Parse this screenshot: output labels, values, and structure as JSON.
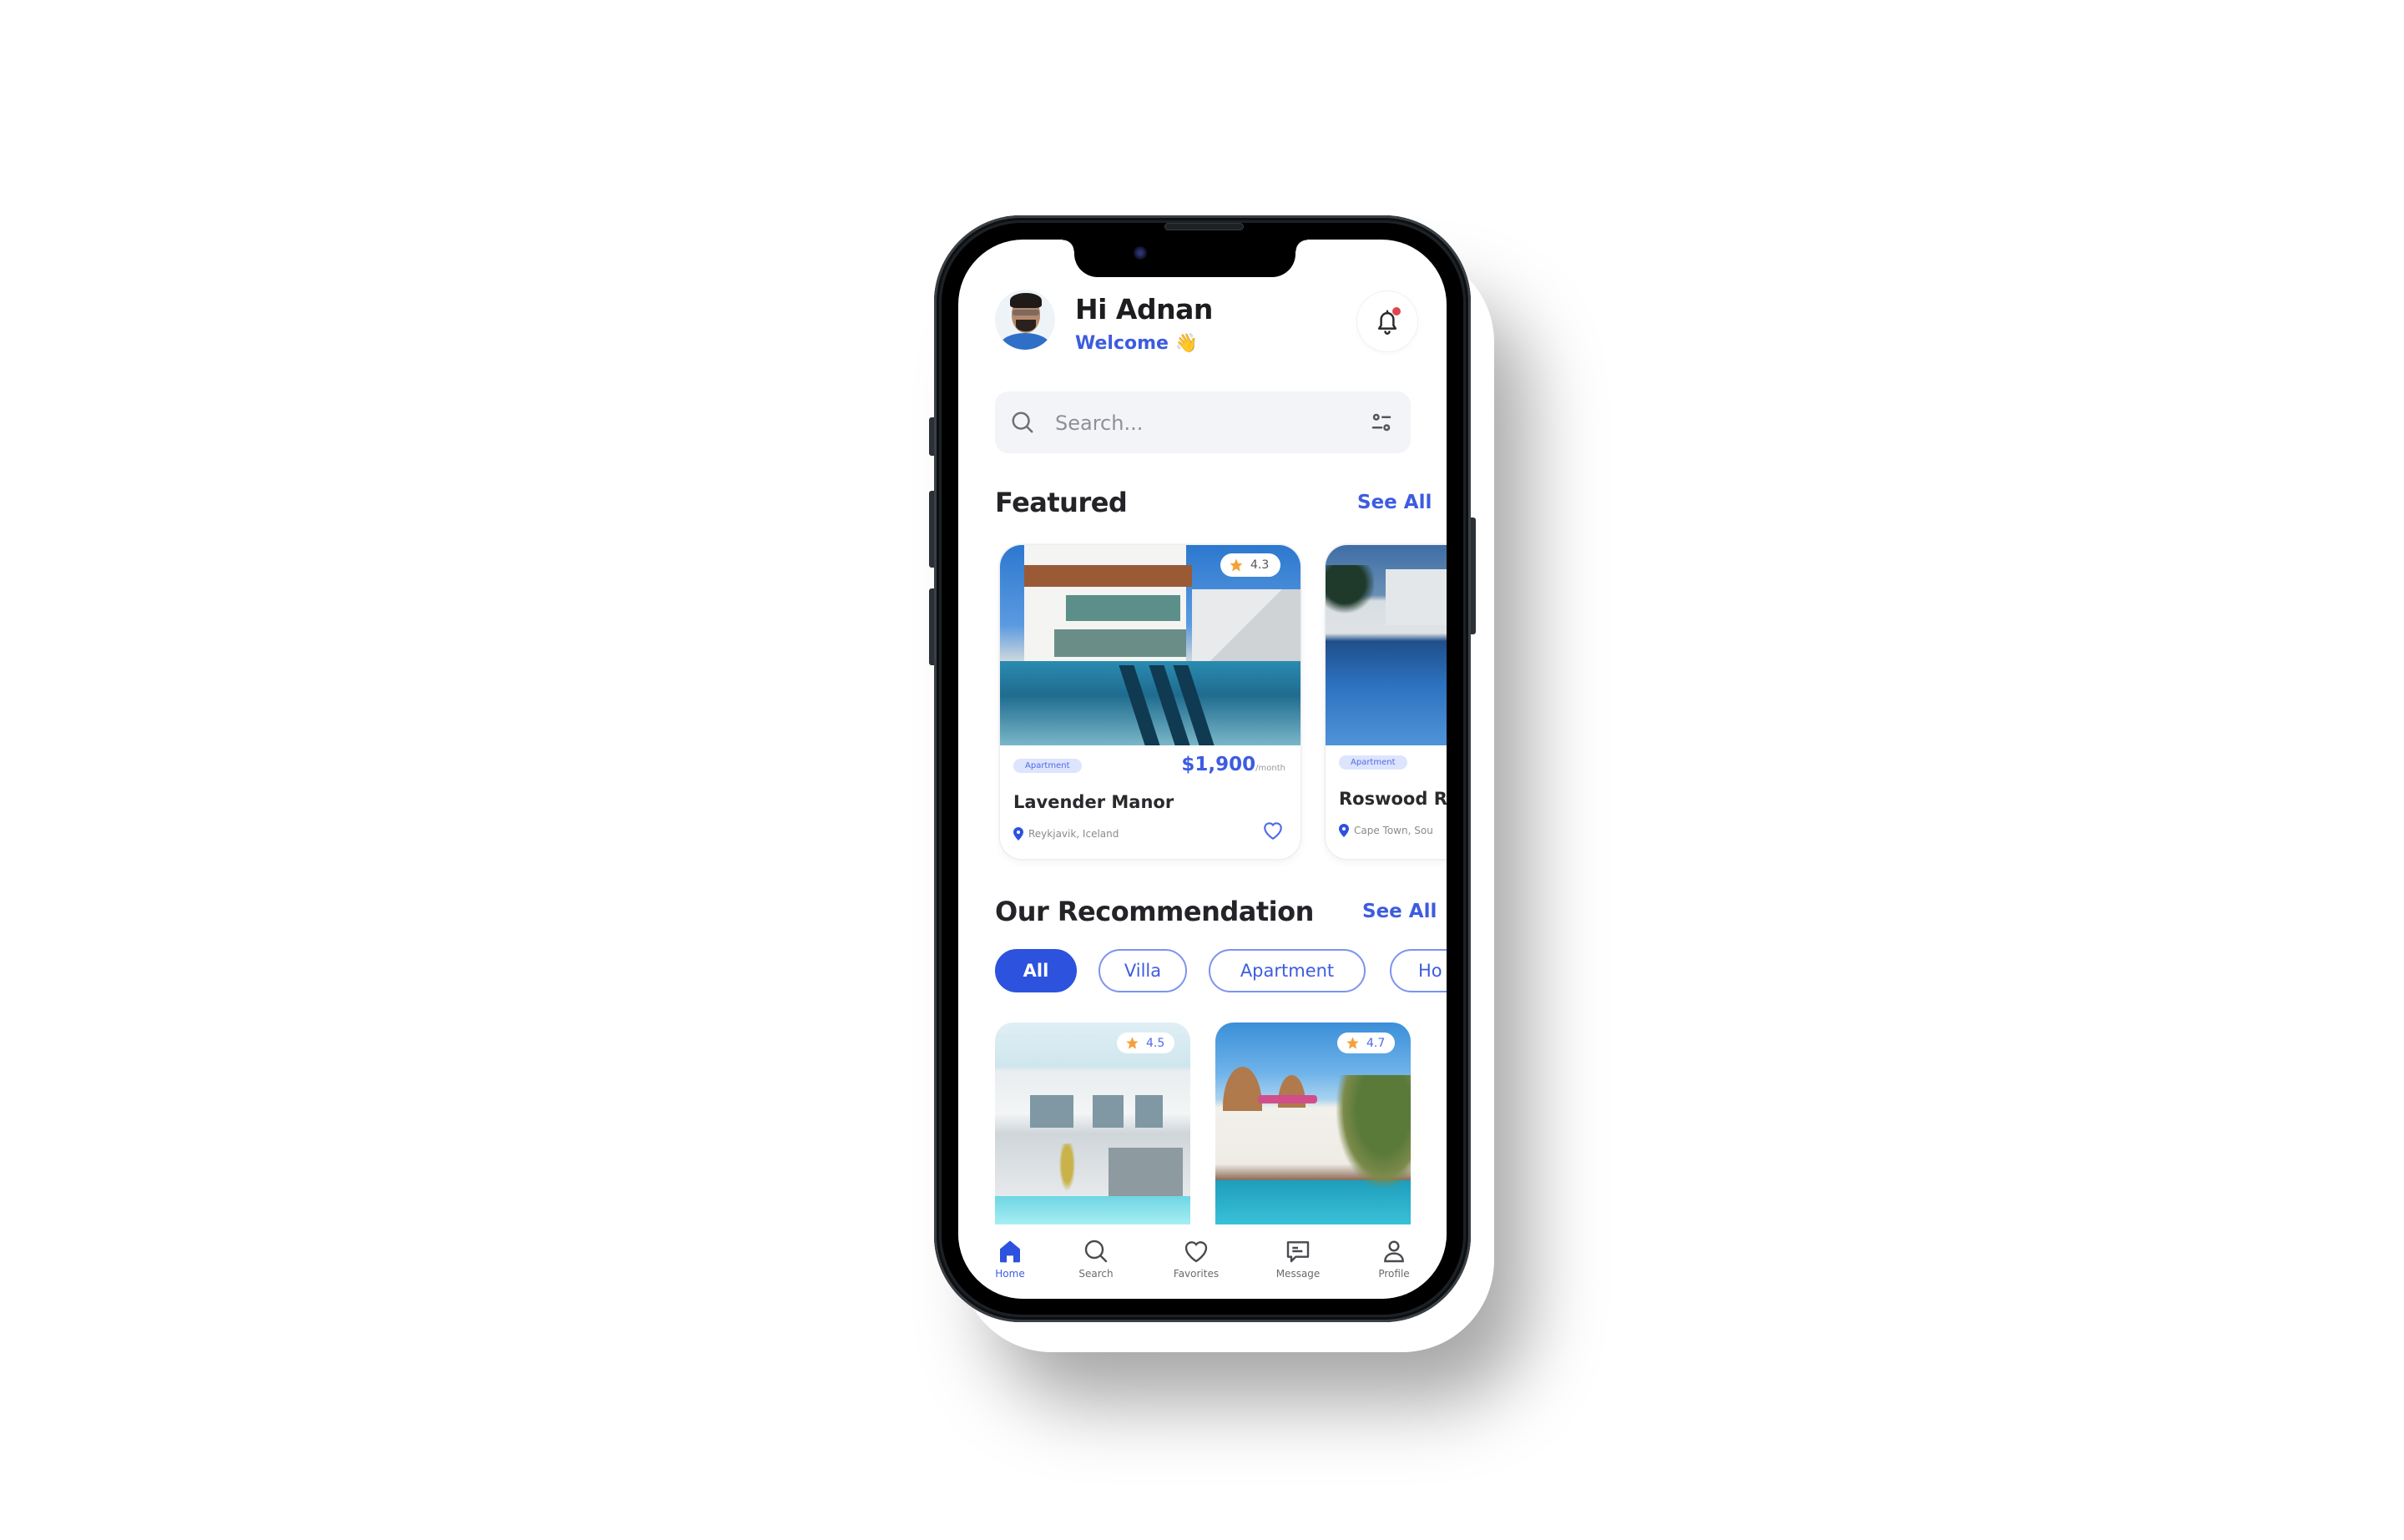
{
  "header": {
    "greeting": "Hi Adnan",
    "subtitle": "Welcome",
    "subtitle_emoji": "👋",
    "avatar_icon": "user-avatar",
    "notification_icon": "bell-icon",
    "has_unread_notification": true
  },
  "search": {
    "placeholder": "Search...",
    "value": "",
    "search_icon": "search-icon",
    "filter_icon": "filter-sliders-icon"
  },
  "featured": {
    "title": "Featured",
    "see_all": "See All",
    "cards": [
      {
        "rating": "4.3",
        "type": "Apartment",
        "price": "$1,900",
        "price_period": "/month",
        "name": "Lavender Manor",
        "location": "Reykjavik, Iceland",
        "favorite_icon": "heart-icon"
      },
      {
        "type": "Apartment",
        "name": "Roswood Re",
        "location": "Cape Town, Sou"
      }
    ]
  },
  "recommendation": {
    "title": "Our Recommendation",
    "see_all": "See All",
    "filters": [
      {
        "label": "All",
        "active": true
      },
      {
        "label": "Villa",
        "active": false
      },
      {
        "label": "Apartment",
        "active": false
      },
      {
        "label": "Ho",
        "active": false
      }
    ],
    "cards": [
      {
        "rating": "4.5"
      },
      {
        "rating": "4.7"
      }
    ]
  },
  "bottom_nav": {
    "items": [
      {
        "label": "Home",
        "icon": "home-icon",
        "active": true
      },
      {
        "label": "Search",
        "icon": "search-icon",
        "active": false
      },
      {
        "label": "Favorites",
        "icon": "heart-icon",
        "active": false
      },
      {
        "label": "Message",
        "icon": "message-icon",
        "active": false
      },
      {
        "label": "Profile",
        "icon": "profile-icon",
        "active": false
      }
    ]
  },
  "colors": {
    "primary": "#2c52de",
    "accent_text": "#3d5ce0",
    "chip_border": "#7d93ee",
    "tag_bg": "#dde4fd",
    "search_bg": "#f3f4f8",
    "star": "#f5a13a",
    "notification_dot": "#e0454f",
    "phone_frame": "#1c2126"
  }
}
